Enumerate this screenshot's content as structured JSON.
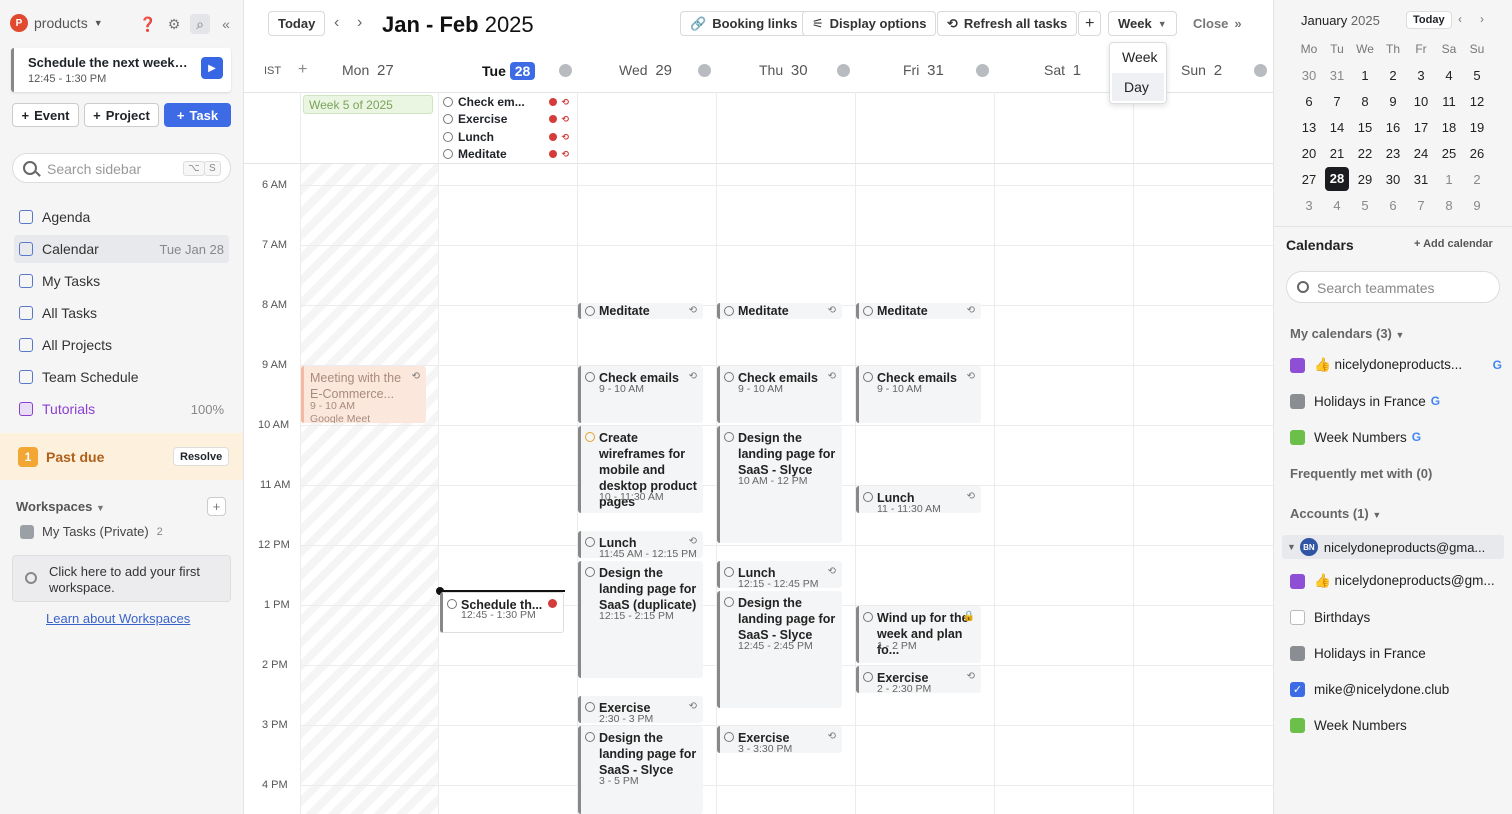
{
  "sidebar": {
    "workspace": "products",
    "workspace_initial": "P",
    "schedule_card": {
      "title": "Schedule the next week o...",
      "time": "12:45 - 1:30 PM"
    },
    "create": {
      "event": "Event",
      "project": "Project",
      "task": "Task"
    },
    "search": {
      "placeholder": "Search sidebar",
      "k1": "⌥",
      "k2": "S"
    },
    "nav": [
      {
        "label": "Agenda",
        "right": ""
      },
      {
        "label": "Calendar",
        "right": "Tue Jan 28"
      },
      {
        "label": "My Tasks",
        "right": ""
      },
      {
        "label": "All Tasks",
        "right": ""
      },
      {
        "label": "All Projects",
        "right": ""
      },
      {
        "label": "Team Schedule",
        "right": ""
      },
      {
        "label": "Tutorials",
        "right": "100%"
      }
    ],
    "past_due": {
      "count": "1",
      "label": "Past due",
      "button": "Resolve"
    },
    "workspaces": {
      "heading": "Workspaces",
      "item": "My Tasks (Private)",
      "item_count": "2"
    },
    "tip": "Click here to add your first workspace.",
    "learn_link": "Learn about Workspaces"
  },
  "toolbar": {
    "today": "Today",
    "title_months": "Jan - Feb",
    "title_year": "2025",
    "booking": "Booking links",
    "display": "Display options",
    "refresh": "Refresh all tasks",
    "plus": "+",
    "view": "Week",
    "close": "Close",
    "dropdown": [
      "Week",
      "Day"
    ]
  },
  "calendar": {
    "tz": "IST",
    "days": [
      {
        "name": "Mon",
        "num": "27"
      },
      {
        "name": "Tue",
        "num": "28"
      },
      {
        "name": "Wed",
        "num": "29"
      },
      {
        "name": "Thu",
        "num": "30"
      },
      {
        "name": "Fri",
        "num": "31"
      },
      {
        "name": "Sat",
        "num": "1"
      },
      {
        "name": "Sun",
        "num": "2"
      }
    ],
    "allday": {
      "week_label": "Week 5 of 2025",
      "tasks": [
        "Check em...",
        "Exercise",
        "Lunch",
        "Meditate"
      ]
    },
    "hours": [
      "6 AM",
      "7 AM",
      "8 AM",
      "9 AM",
      "10 AM",
      "11 AM",
      "12 PM",
      "1 PM",
      "2 PM",
      "3 PM",
      "4 PM"
    ],
    "events": {
      "mon_meeting": {
        "title": "Meeting with the E-Commerce...",
        "time": "9 - 10 AM",
        "sub": "Google Meet"
      },
      "tue_schedule": {
        "title": "Schedule th...",
        "time": "12:45 - 1:30 PM"
      },
      "wed_meditate": {
        "title": "Meditate"
      },
      "wed_check": {
        "title": "Check emails",
        "time": "9 - 10 AM"
      },
      "wed_wire": {
        "title": "Create wireframes for mobile and desktop product pages",
        "time": "10 - 11:30 AM"
      },
      "wed_lunch": {
        "title": "Lunch",
        "time": "11:45 AM - 12:15 PM"
      },
      "wed_landing": {
        "title": "Design the landing page for SaaS (duplicate)",
        "time": "12:15 - 2:15 PM"
      },
      "wed_exercise": {
        "title": "Exercise",
        "time": "2:30 - 3 PM"
      },
      "wed_landing2": {
        "title": "Design the landing page for SaaS - Slyce",
        "time": "3 - 5 PM"
      },
      "thu_meditate": {
        "title": "Meditate"
      },
      "thu_check": {
        "title": "Check emails",
        "time": "9 - 10 AM"
      },
      "thu_landing": {
        "title": "Design the landing page for SaaS - Slyce",
        "time": "10 AM - 12 PM"
      },
      "thu_lunch": {
        "title": "Lunch",
        "time": "12:15 - 12:45 PM"
      },
      "thu_landing2": {
        "title": "Design the landing page for SaaS - Slyce",
        "time": "12:45 - 2:45 PM"
      },
      "thu_exercise": {
        "title": "Exercise",
        "time": "3 - 3:30 PM"
      },
      "fri_meditate": {
        "title": "Meditate"
      },
      "fri_check": {
        "title": "Check emails",
        "time": "9 - 10 AM"
      },
      "fri_lunch": {
        "title": "Lunch",
        "time": "11 - 11:30 AM"
      },
      "fri_wind": {
        "title": "Wind up for the week and plan fo...",
        "time": "1 - 2 PM"
      },
      "fri_exercise": {
        "title": "Exercise",
        "time": "2 - 2:30 PM"
      }
    }
  },
  "minical": {
    "month": "January",
    "year": "2025",
    "today_btn": "Today",
    "dow": [
      "Mo",
      "Tu",
      "We",
      "Th",
      "Fr",
      "Sa",
      "Su"
    ],
    "weeks": [
      [
        "30",
        "31",
        "1",
        "2",
        "3",
        "4",
        "5"
      ],
      [
        "6",
        "7",
        "8",
        "9",
        "10",
        "11",
        "12"
      ],
      [
        "13",
        "14",
        "15",
        "16",
        "17",
        "18",
        "19"
      ],
      [
        "20",
        "21",
        "22",
        "23",
        "24",
        "25",
        "26"
      ],
      [
        "27",
        "28",
        "29",
        "30",
        "31",
        "1",
        "2"
      ],
      [
        "3",
        "4",
        "5",
        "6",
        "7",
        "8",
        "9"
      ]
    ]
  },
  "calendars": {
    "heading": "Calendars",
    "add": "Add calendar",
    "search_placeholder": "Search teammates",
    "my_heading": "My calendars (3)",
    "my": [
      {
        "label": "👍 nicelydoneproducts...",
        "color": "#8e4fd6",
        "google": "G"
      },
      {
        "label": "Holidays in France",
        "color": "#8a8d91",
        "google": "G"
      },
      {
        "label": "Week Numbers",
        "color": "#6cc04a",
        "google": "G"
      }
    ],
    "freq": "Frequently met with (0)",
    "accounts_heading": "Accounts (1)",
    "account": {
      "initials": "BN",
      "email": "nicelydoneproducts@gma..."
    },
    "account_cals": [
      {
        "label": "👍 nicelydoneproducts@gm...",
        "color": "#8e4fd6",
        "checked": "full"
      },
      {
        "label": "Birthdays",
        "color": "#ffffff",
        "checked": "none"
      },
      {
        "label": "Holidays in France",
        "color": "#8a8d91",
        "checked": "full"
      },
      {
        "label": "mike@nicelydone.club",
        "color": "#3d6be6",
        "checked": "check"
      },
      {
        "label": "Week Numbers",
        "color": "#6cc04a",
        "checked": "full"
      }
    ]
  }
}
